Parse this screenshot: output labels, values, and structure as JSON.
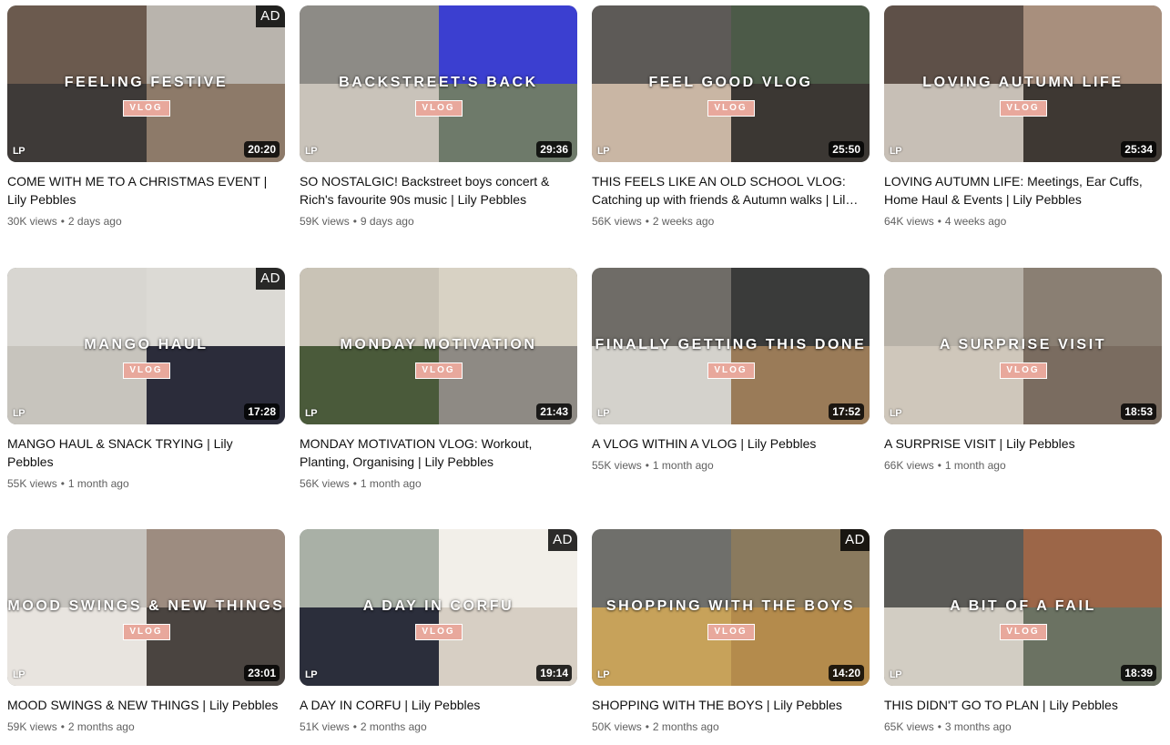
{
  "videos": [
    {
      "title": "COME WITH ME TO A CHRISTMAS EVENT | Lily Pebbles",
      "overlay": "FEELING FESTIVE",
      "badge": "VLOG",
      "logo": "LP",
      "duration": "20:20",
      "ad": "AD",
      "views": "30K views",
      "age": "2 days ago"
    },
    {
      "title": "SO NOSTALGIC! Backstreet boys concert & Rich's favourite 90s music | Lily Pebbles",
      "overlay": "BACKSTREET'S BACK",
      "badge": "VLOG",
      "logo": "LP",
      "duration": "29:36",
      "ad": "",
      "views": "59K views",
      "age": "9 days ago"
    },
    {
      "title": "THIS FEELS LIKE AN OLD SCHOOL VLOG: Catching up with friends & Autumn walks | Lily Pebbles",
      "overlay": "FEEL GOOD VLOG",
      "badge": "VLOG",
      "logo": "LP",
      "duration": "25:50",
      "ad": "",
      "views": "56K views",
      "age": "2 weeks ago"
    },
    {
      "title": "LOVING AUTUMN LIFE: Meetings, Ear Cuffs, Home Haul & Events | Lily Pebbles",
      "overlay": "LOVING AUTUMN LIFE",
      "badge": "VLOG",
      "logo": "LP",
      "duration": "25:34",
      "ad": "",
      "views": "64K views",
      "age": "4 weeks ago"
    },
    {
      "title": "MANGO HAUL & SNACK TRYING | Lily Pebbles",
      "overlay": "MANGO HAUL",
      "badge": "VLOG",
      "logo": "LP",
      "duration": "17:28",
      "ad": "AD",
      "views": "55K views",
      "age": "1 month ago"
    },
    {
      "title": "MONDAY MOTIVATION VLOG: Workout, Planting, Organising | Lily Pebbles",
      "overlay": "MONDAY MOTIVATION",
      "badge": "VLOG",
      "logo": "LP",
      "duration": "21:43",
      "ad": "",
      "views": "56K views",
      "age": "1 month ago"
    },
    {
      "title": "A VLOG WITHIN A VLOG | Lily Pebbles",
      "overlay": "FINALLY GETTING THIS DONE",
      "badge": "VLOG",
      "logo": "LP",
      "duration": "17:52",
      "ad": "",
      "views": "55K views",
      "age": "1 month ago"
    },
    {
      "title": "A SURPRISE VISIT | Lily Pebbles",
      "overlay": "A SURPRISE VISIT",
      "badge": "VLOG",
      "logo": "LP",
      "duration": "18:53",
      "ad": "",
      "views": "66K views",
      "age": "1 month ago"
    },
    {
      "title": "MOOD SWINGS & NEW THINGS | Lily Pebbles",
      "overlay": "MOOD SWINGS & NEW THINGS",
      "badge": "VLOG",
      "logo": "LP",
      "duration": "23:01",
      "ad": "",
      "views": "59K views",
      "age": "2 months ago"
    },
    {
      "title": "A DAY IN CORFU | Lily Pebbles",
      "overlay": "A DAY IN CORFU",
      "badge": "VLOG",
      "logo": "LP",
      "duration": "19:14",
      "ad": "AD",
      "views": "51K views",
      "age": "2 months ago"
    },
    {
      "title": "SHOPPING WITH THE BOYS | Lily Pebbles",
      "overlay": "SHOPPING WITH THE BOYS",
      "badge": "VLOG",
      "logo": "LP",
      "duration": "14:20",
      "ad": "AD",
      "views": "50K views",
      "age": "2 months ago"
    },
    {
      "title": "THIS DIDN'T GO TO PLAN | Lily Pebbles",
      "overlay": "A BIT OF A FAIL",
      "badge": "VLOG",
      "logo": "LP",
      "duration": "18:39",
      "ad": "",
      "views": "65K views",
      "age": "3 months ago"
    }
  ],
  "colors": {
    "badge_bg": "#e8a89c",
    "meta_text": "#606060",
    "title_text": "#0f0f0f",
    "thumb_palettes": [
      [
        "#6b5a4e",
        "#b9b4ad",
        "#3e3a38",
        "#8d7a69"
      ],
      [
        "#8d8b86",
        "#3b3fd0",
        "#c9c3ba",
        "#6e7a6a"
      ],
      [
        "#5d5a57",
        "#4c5a48",
        "#c9b6a4",
        "#3b3733"
      ],
      [
        "#5e5048",
        "#a88f7d",
        "#c7bfb6",
        "#3e3833"
      ],
      [
        "#d8d6d1",
        "#dcdad5",
        "#c7c4bd",
        "#2b2c3a"
      ],
      [
        "#c9c3b6",
        "#d8d2c4",
        "#4a5a3a",
        "#8e8a84"
      ],
      [
        "#6f6c67",
        "#3a3b3a",
        "#d4d2cc",
        "#9a7b58"
      ],
      [
        "#b8b2a8",
        "#8a7f73",
        "#cfc7bb",
        "#7a6c60"
      ],
      [
        "#c6c3be",
        "#9d8c80",
        "#e8e4df",
        "#4a4440"
      ],
      [
        "#a9b0a6",
        "#f2efe9",
        "#2b2e3b",
        "#d7cfc4"
      ],
      [
        "#6f6f6b",
        "#8a7a5e",
        "#c7a25a",
        "#b48b4c"
      ],
      [
        "#5b5a56",
        "#9c6648",
        "#d2cdc3",
        "#6b7262"
      ]
    ]
  }
}
